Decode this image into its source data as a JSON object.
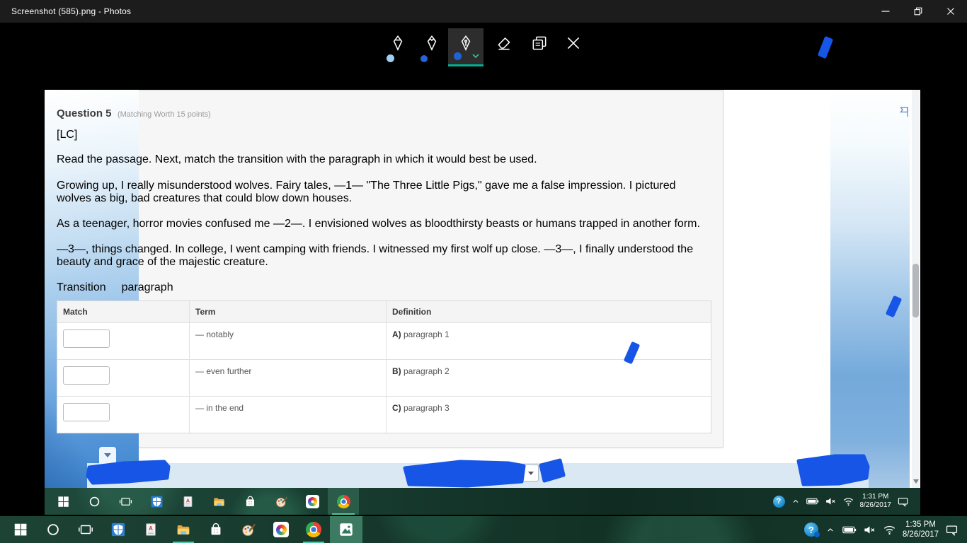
{
  "window": {
    "title": "Screenshot (585).png - Photos"
  },
  "ink_toolbar": {
    "tools": [
      "ballpoint-pen",
      "pencil",
      "calligraphy-pen",
      "eraser",
      "save-a-copy",
      "close-ink"
    ],
    "selected_tool": "calligraphy-pen",
    "pen_dot_colors": [
      "#9fd0ef",
      "#2563d8",
      "#1e63d6"
    ]
  },
  "quiz": {
    "question_title": "Question 5",
    "question_meta": "(Matching Worth 15 points)",
    "tag": "[LC]",
    "instruction": "Read the passage. Next, match the transition with the paragraph in which it would best be used.",
    "paragraphs": [
      "Growing up, I really misunderstood wolves. Fairy tales, —1— \"The Three Little Pigs,\" gave me a false impression. I pictured wolves as big, bad creatures that could blow down houses.",
      "As a teenager, horror movies confused me —2—. I envisioned wolves as bloodthirsty beasts or humans trapped in another form.",
      "—3—, things changed. In college, I went camping with friends. I witnessed my first wolf up close. —3—, I finally understood the beauty and grace of the majestic creature."
    ],
    "matching_labels": {
      "transition": "Transition",
      "paragraph": "paragraph"
    },
    "table": {
      "headers": [
        "Match",
        "Term",
        "Definition"
      ],
      "rows": [
        {
          "match_value": "",
          "term": "— notably",
          "definition_letter": "A)",
          "definition_text": " paragraph 1"
        },
        {
          "match_value": "",
          "term": "— even further",
          "definition_letter": "B)",
          "definition_text": " paragraph 2"
        },
        {
          "match_value": "",
          "term": "— in the end",
          "definition_letter": "C)",
          "definition_text": " paragraph 3"
        }
      ]
    }
  },
  "inner_taskbar": {
    "clock": {
      "time": "1:31 PM",
      "date": "8/26/2017"
    },
    "pinned_apps": [
      "start",
      "cortana",
      "task-view",
      "defender",
      "document-a",
      "file-explorer",
      "store",
      "paint",
      "color-circle-app",
      "chrome"
    ]
  },
  "taskbar": {
    "clock": {
      "time": "1:35 PM",
      "date": "8/26/2017"
    },
    "pinned_apps": [
      "start",
      "cortana",
      "task-view",
      "defender",
      "document-a",
      "file-explorer",
      "store",
      "paint",
      "color-circle-app",
      "chrome",
      "photos"
    ]
  },
  "icons": {
    "help_glyph": "?"
  },
  "colors": {
    "ink_blue": "#1655e6",
    "ink_accent_teal": "#00b294",
    "taskbar_green": "#16382c",
    "bottom_bar_blue": "#d9e8f3",
    "defender_blue": "#2b7cd3"
  }
}
